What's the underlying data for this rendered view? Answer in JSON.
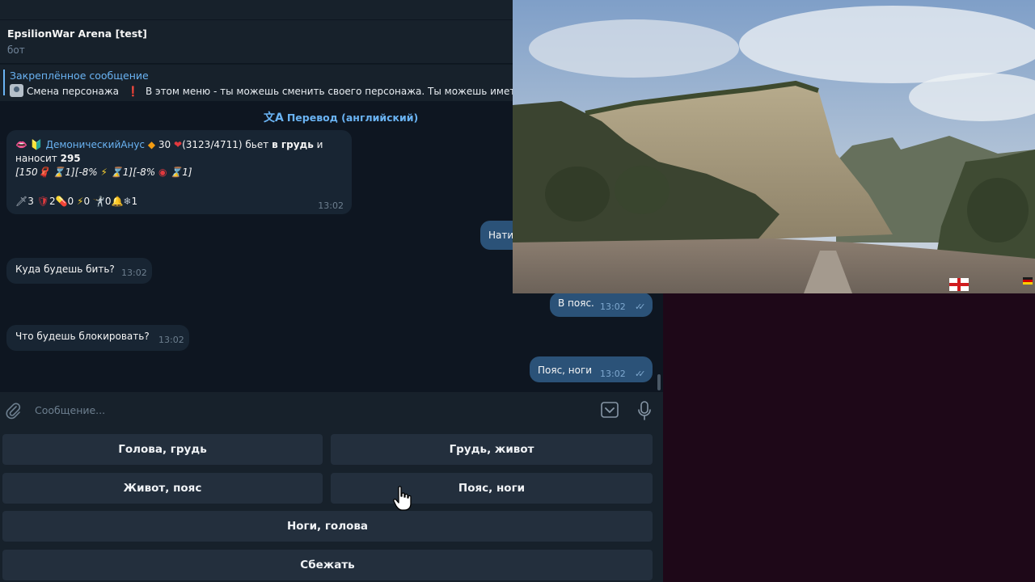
{
  "header": {
    "title": "EpsilionWar Arena [test]",
    "subtitle": "бот"
  },
  "pinned": {
    "title": "Закреплённое сообщение",
    "label": "Смена персонажа",
    "text": "В этом меню - ты можешь сменить своего персонажа. Ты можешь иметь"
  },
  "translate": {
    "label": "Перевод (английский)"
  },
  "messages": {
    "battle": {
      "name": "ДемоническийАнус",
      "level": "30",
      "hp": "(3123/4711)",
      "action": "бьет",
      "target": "в грудь",
      "and": "и",
      "damage_label": "наносит",
      "damage": "295",
      "line3_a": "[150",
      "line3_b": "1][-8%",
      "line3_c": "1][-8%",
      "line3_d": "1]",
      "stat1": "3",
      "stat2": "2",
      "stat3": "0",
      "stat4": "0",
      "stat5": "0",
      "stat6": "1",
      "time": "13:02"
    },
    "nati": {
      "text": "Нати"
    },
    "m1": {
      "text": "Куда будешь бить?",
      "time": "13:02"
    },
    "m2": {
      "text": "В пояс.",
      "time": "13:02"
    },
    "m3": {
      "text": "Что будешь блокировать?",
      "time": "13:02"
    },
    "m4": {
      "text": "Пояс, ноги",
      "time": "13:02"
    }
  },
  "composer": {
    "placeholder": "Сообщение..."
  },
  "keyboard": {
    "b1": "Голова, грудь",
    "b2": "Грудь, живот",
    "b3": "Живот, пояс",
    "b4": "Пояс, ноги",
    "b5": "Ноги, голова",
    "b6": "Сбежать"
  },
  "icons": {
    "attach": "paperclip-icon",
    "keyboard": "bot-keyboard-icon",
    "mic": "microphone-icon",
    "translate": "translate-icon"
  },
  "colors": {
    "chat_bg": "#0e1621",
    "panel_bg": "#17212b",
    "incoming_bubble": "#182533",
    "outgoing_bubble": "#2b5278",
    "accent": "#6ab3f3",
    "keyboard_button": "#232f3d"
  }
}
